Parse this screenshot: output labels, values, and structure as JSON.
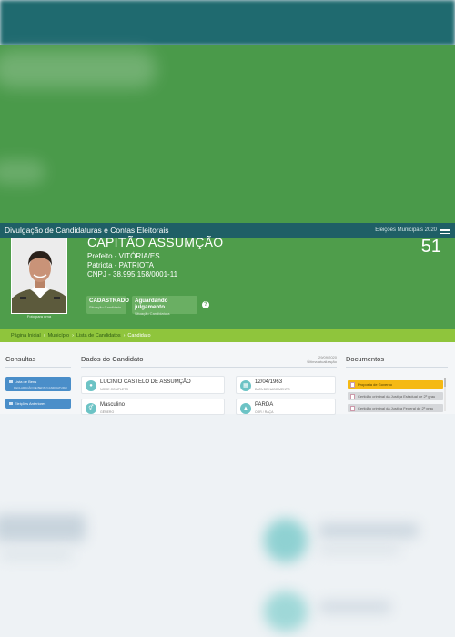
{
  "header": {
    "title": "Divulgação de Candidaturas e Contas Eleitorais",
    "election": "Eleições Municipais 2020"
  },
  "candidate": {
    "ballot_name": "CAPITÃO ASSUMÇÃO",
    "office": "Prefeito - VITÓRIA/ES",
    "party": "Patriota - PATRIOTA",
    "cnpj": "CNPJ - 38.995.158/0001-11",
    "number": "51",
    "photo_caption": "Foto para urna",
    "status": {
      "candidate_value": "CADASTRADO",
      "candidate_label": "Situação Candidato",
      "candidacy_value": "Aguardando julgamento",
      "candidacy_label": "Situação Candidatura"
    },
    "help": "?"
  },
  "breadcrumb": [
    "Página Inicial",
    "Município",
    "Lista de Candidatos",
    "Candidato"
  ],
  "breadcrumb_sep": "›",
  "consultas": {
    "title": "Consultas",
    "buttons": [
      {
        "label": "Lista de Bens",
        "sub": "DECLARAÇÃO DE BENS (CANDIDATURA)"
      },
      {
        "label": "Eleições Anteriores",
        "sub": ""
      }
    ]
  },
  "dados": {
    "title": "Dados do Candidato",
    "updated_date": "29/09/2020",
    "updated_label": "Última atualização",
    "fields": [
      {
        "value": "LUCINIO CASTELO DE ASSUMÇÃO",
        "label": "NOME COMPLETO",
        "icon": "person-icon"
      },
      {
        "value": "12/04/1963",
        "label": "DATA DE NASCIMENTO",
        "icon": "calendar-icon"
      },
      {
        "value": "Masculino",
        "label": "GÊNERO",
        "icon": "gender-icon"
      },
      {
        "value": "PARDA",
        "label": "COR / RAÇA",
        "icon": "race-icon"
      }
    ]
  },
  "documentos": {
    "title": "Documentos",
    "items": [
      "Proposta de Governo",
      "Certidão criminal da Justiça Estadual de 2º grau",
      "Certidão criminal da Justiça Federal de 2º grau"
    ]
  },
  "colors": {
    "header_bg": "#1f5f66",
    "candidate_bg": "#4f9d4b",
    "breadcrumb_bg": "#8fc53c",
    "button_blue": "#4a8ec9",
    "doc_yellow": "#f5b914"
  }
}
